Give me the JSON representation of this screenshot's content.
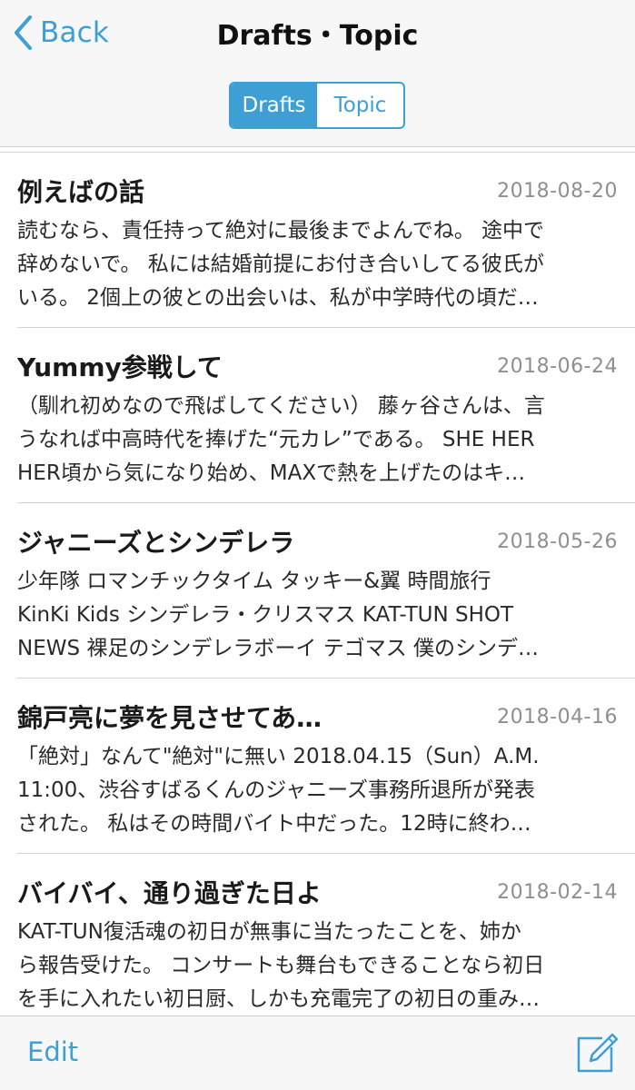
{
  "nav": {
    "back_label": "Back",
    "title": "Drafts・Topic",
    "segments": [
      {
        "label": "Drafts",
        "selected": true
      },
      {
        "label": "Topic",
        "selected": false
      }
    ]
  },
  "drafts": [
    {
      "title": "例えばの話",
      "date": "2018-08-20",
      "preview": [
        "読むなら、責任持って絶対に最後までよんでね。 途中で",
        "辞めないで。 私には結婚前提にお付き合いしてる彼氏が",
        "いる。 2個上の彼との出会いは、私が中学時代の頃だ…"
      ]
    },
    {
      "title": "Yummy参戦して",
      "date": "2018-06-24",
      "preview": [
        "（馴れ初めなので飛ばしてください） 藤ヶ谷さんは、言",
        "うなれば中高時代を捧げた“元カレ”である。 SHE HER",
        "HER頃から気になり始め、MAXで熱を上げたのはキ…"
      ]
    },
    {
      "title": "ジャニーズとシンデレラ",
      "date": "2018-05-26",
      "preview": [
        "少年隊 ロマンチックタイム タッキー&翼 時間旅行",
        "KinKi Kids シンデレラ・クリスマス KAT-TUN SHOT",
        "NEWS 裸足のシンデレラボーイ テゴマス 僕のシンデ…"
      ]
    },
    {
      "title": "錦戸亮に夢を見させてあ…",
      "date": "2018-04-16",
      "preview": [
        "「絶対」なんて\"絶対\"に無い 2018.04.15（Sun）A.M.",
        "11:00、渋谷すばるくんのジャニーズ事務所退所が発表",
        "された。 私はその時間バイト中だった。12時に終わ…"
      ]
    },
    {
      "title": "バイバイ、通り過ぎた日よ",
      "date": "2018-02-14",
      "preview": [
        "KAT-TUN復活魂の初日が無事に当たったことを、姉か",
        "ら報告受けた。 コンサートも舞台もできることなら初日",
        "を手に入れたい初日厨、しかも充電完了の初日の重み…"
      ]
    }
  ],
  "toolbar": {
    "edit_label": "Edit"
  },
  "colors": {
    "accent": "#3e9fd5",
    "date": "#8e8e93",
    "bar_background": "#f7f7f8",
    "divider": "#d4d4d6"
  },
  "icons": {
    "back": "chevron-left-icon",
    "compose": "compose-icon"
  }
}
